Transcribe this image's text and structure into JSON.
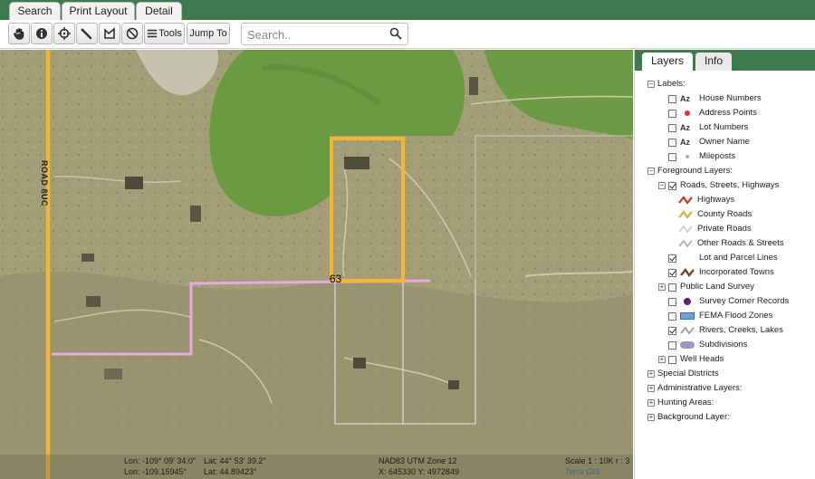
{
  "top_tabs": [
    "Search",
    "Print Layout",
    "Detail"
  ],
  "toolbar": {
    "tools_label": "Tools",
    "jump_to_label": "Jump To",
    "search_placeholder": "Search.."
  },
  "map": {
    "road_label": "ROAD 8UC",
    "highway_label": "63",
    "status": {
      "lon_dms": "Lon: -109° 09' 34.0\"",
      "lat_dms": "Lat: 44° 53' 39.2\"",
      "lon_dec": "Lon: -109.15945°",
      "lat_dec": "Lat: 44.89423°",
      "projection": "NAD83 UTM Zone 12",
      "xy": "X: 645330 Y: 4972849",
      "scale": "Scale 1 : 10K r : 3",
      "credit": "Terra GIS"
    }
  },
  "panel": {
    "tabs": [
      "Layers",
      "Info"
    ],
    "labels_group": "Labels:",
    "label_items": [
      "House Numbers",
      "Address Points",
      "Lot Numbers",
      "Owner Name",
      "Mileposts"
    ],
    "foreground_group": "Foreground Layers:",
    "roads_group": "Roads, Streets, Highways",
    "road_items": [
      "Highways",
      "County Roads",
      "Private Roads",
      "Other Roads & Streets"
    ],
    "layer_items": [
      "Lot and Parcel Lines",
      "Incorporated Towns",
      "Public Land Survey",
      "Survey Corner Records",
      "FEMA Flood Zones",
      "Rivers, Creeks, Lakes",
      "Subdivisions",
      "Well Heads"
    ],
    "bottom_groups": [
      "Special Districts",
      "Administrative Layers:",
      "Hunting Areas:",
      "Background Layer:"
    ],
    "symbols": {
      "az": "Az",
      "address_dot_color": "#e03030",
      "milepost_dot_color": "#b0b0b0",
      "survey_corner_color": "#6a1e7a",
      "fema_color": "#6fa3d8",
      "rivers_color": "#9a9ab5",
      "subdivision_color": "#9e95c4"
    }
  },
  "colors": {
    "header_green": "#3d7a4f",
    "highway_yellow": "#f2b632",
    "boundary_pink": "#e6a9e0",
    "parcel_line": "#e0e0e0"
  }
}
